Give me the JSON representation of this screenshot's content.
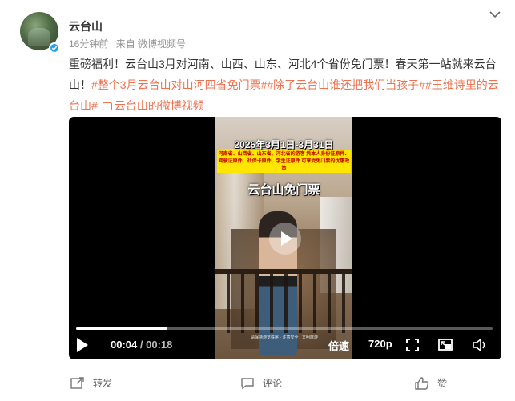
{
  "user": {
    "name": "云台山",
    "time": "16分钟前",
    "source": "来自 微博视频号"
  },
  "post": {
    "text": "重磅福利！云台山3月对河南、山西、山东、河北4个省份免门票！春天第一站就来云台山！",
    "tags": [
      "#整个3月云台山对山河四省免门票#",
      "#除了云台山谁还把我们当孩子#",
      "#王维诗里的云台山#"
    ],
    "video_link": "云台山的微博视频"
  },
  "video": {
    "overlay_date": "2026年3月1日-3月31日",
    "overlay_notice": "河南省、山西省、山东省、河北省的游客 凭本人身份证原件、驾驶证原件、社保卡原件、学生证原件 可享受免门票的优惠政策",
    "overlay_title": "云台山免门票",
    "overlay_caption": "请保持游览秩序 · 注意安全 · 文明旅游",
    "current_time": "00:04",
    "duration": "00:18",
    "progress": 0.22,
    "speed_label": "倍速",
    "quality_label": "720p"
  },
  "actions": {
    "repost": "转发",
    "comment": "评论",
    "like": "赞"
  },
  "colors": {
    "tag": "#eb7350",
    "verified": "#1da1f2"
  }
}
